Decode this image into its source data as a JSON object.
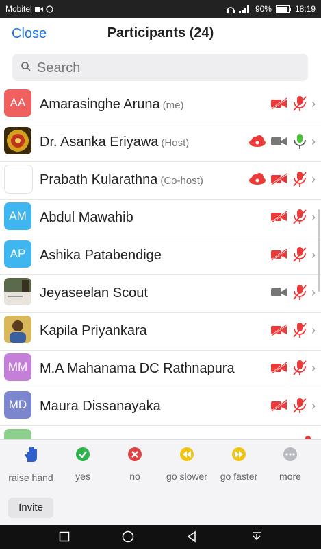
{
  "status": {
    "carrier": "Mobitel",
    "battery": "90%",
    "time": "18:19"
  },
  "header": {
    "close_label": "Close",
    "title": "Participants (24)"
  },
  "search": {
    "placeholder": "Search"
  },
  "participants": [
    {
      "initials": "AA",
      "name": "Amarasinghe Aruna",
      "role": "(me)",
      "avatar_color": "#f0605f"
    },
    {
      "initials": "",
      "name": "Dr. Asanka Eriyawa",
      "role": "(Host)",
      "avatar_color": "#3a2a0a"
    },
    {
      "initials": "",
      "name": "Prabath Kularathna",
      "role": "(Co-host)",
      "avatar_color": "#ffffff"
    },
    {
      "initials": "AM",
      "name": "Abdul Mawahib",
      "role": "",
      "avatar_color": "#40b6f0"
    },
    {
      "initials": "AP",
      "name": "Ashika Patabendige",
      "role": "",
      "avatar_color": "#40b6f0"
    },
    {
      "initials": "",
      "name": "Jeyaseelan Scout",
      "role": "",
      "avatar_color": "#9aa28f"
    },
    {
      "initials": "",
      "name": "Kapila Priyankara",
      "role": "",
      "avatar_color": "#c9a54a"
    },
    {
      "initials": "MM",
      "name": "M.A Mahanama DC Rathnapura",
      "role": "",
      "avatar_color": "#c480d8"
    },
    {
      "initials": "MD",
      "name": "Maura Dissanayaka",
      "role": "",
      "avatar_color": "#7b86cf"
    },
    {
      "initials": "",
      "name": "",
      "role": "",
      "avatar_color": "#8dcf8d"
    }
  ],
  "reactions": [
    {
      "label": "raise hand",
      "icon": "raise-hand-icon",
      "color": "#2d5ec9"
    },
    {
      "label": "yes",
      "icon": "check-icon",
      "color": "#2db34a"
    },
    {
      "label": "no",
      "icon": "x-icon",
      "color": "#e04343"
    },
    {
      "label": "go slower",
      "icon": "rewind-icon",
      "color": "#f0c414"
    },
    {
      "label": "go faster",
      "icon": "fast-forward-icon",
      "color": "#f0c414"
    },
    {
      "label": "more",
      "icon": "more-icon",
      "color": "#b8b8c0"
    }
  ],
  "invite_label": "Invite",
  "colors": {
    "accent": "#1a73e8",
    "muted_red": "#ec3a3a",
    "mic_green": "#4cbf3a"
  }
}
